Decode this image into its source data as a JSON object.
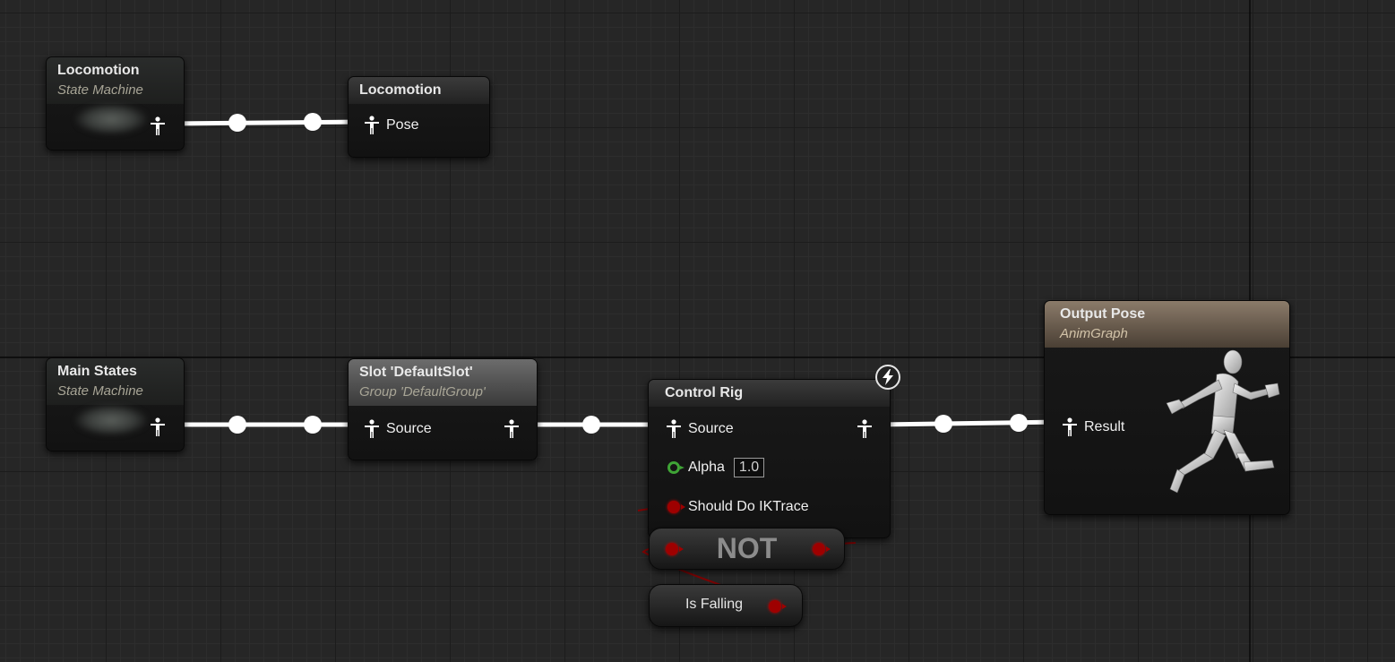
{
  "graph": {
    "locomotion_sm": {
      "title": "Locomotion",
      "subtitle": "State Machine"
    },
    "locomotion_ref": {
      "title": "Locomotion",
      "pins": {
        "pose": "Pose"
      }
    },
    "main_states_sm": {
      "title": "Main States",
      "subtitle": "State Machine"
    },
    "slot_node": {
      "title": "Slot 'DefaultSlot'",
      "subtitle": "Group 'DefaultGroup'",
      "pins": {
        "source": "Source"
      }
    },
    "control_rig": {
      "title": "Control Rig",
      "pins": {
        "source": "Source",
        "alpha": "Alpha",
        "alpha_value": "1.0",
        "should_do_iktrace": "Should Do IKTrace"
      }
    },
    "not_node": {
      "label": "NOT"
    },
    "is_falling": {
      "label": "Is Falling"
    },
    "output_pose": {
      "title": "Output Pose",
      "subtitle": "AnimGraph",
      "pins": {
        "result": "Result"
      }
    }
  },
  "icons": {
    "pose_pin": "pose-pin-icon",
    "float_pin": "float-pin-icon",
    "bool_pin": "bool-pin-icon",
    "event": "lightning-icon",
    "preview": "mannequin-icon"
  },
  "colors": {
    "background": "#262626",
    "pose_wire": "#ffffff",
    "bool_wire": "#9e0000",
    "float_pin": "#3fa436",
    "output_header": "#8b7b6a",
    "slot_header": "#6c6c6c",
    "node_body": "#151515"
  }
}
